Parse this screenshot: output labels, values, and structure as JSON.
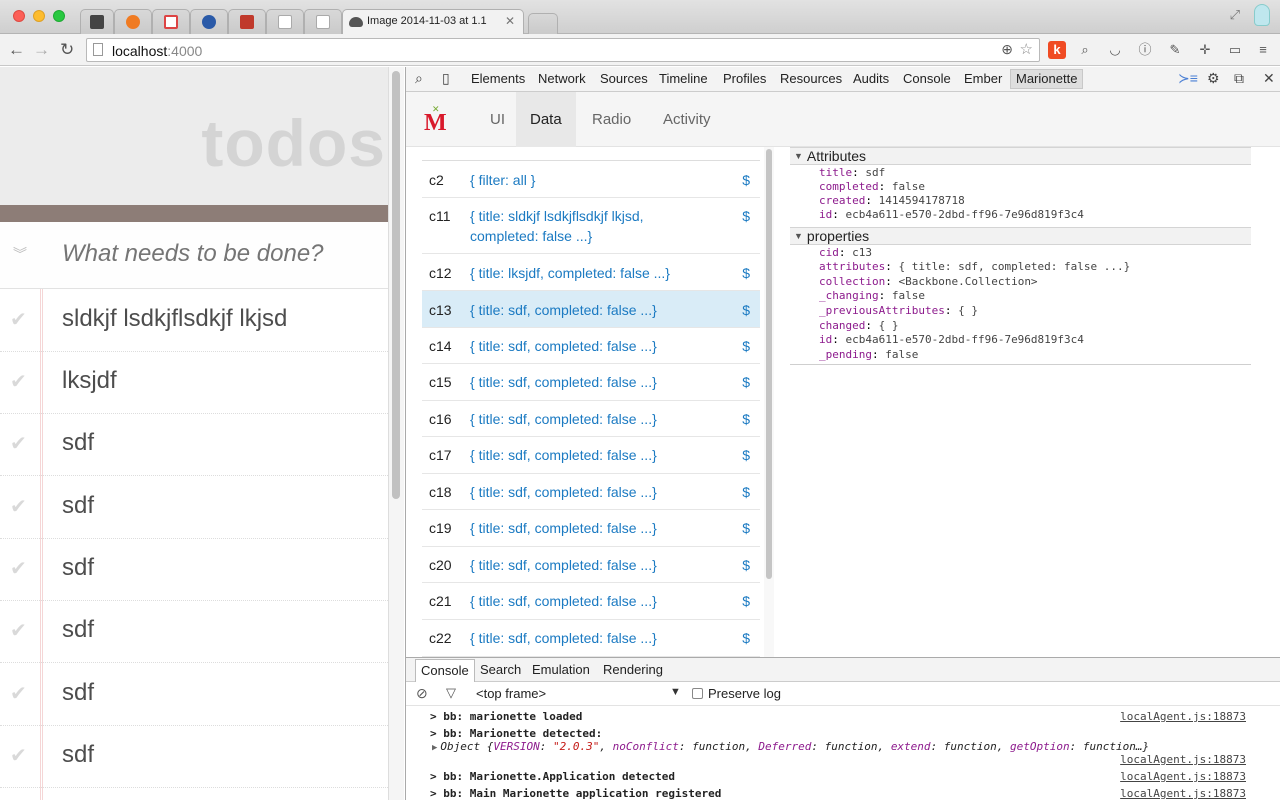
{
  "browser": {
    "tabs": [
      {
        "title": "",
        "favicon_color": "#444"
      },
      {
        "title": "",
        "favicon_color": "#f07b22"
      },
      {
        "title": "",
        "favicon_color": "#d44"
      },
      {
        "title": "",
        "favicon_color": "#2a5aa8"
      },
      {
        "title": "",
        "favicon_color": "#c0392b"
      },
      {
        "title": "",
        "favicon_color": "#ccc"
      },
      {
        "title": "",
        "favicon_color": "#ccc"
      },
      {
        "title": "Image 2014-11-03 at 1.1",
        "favicon_color": "#555"
      }
    ],
    "address": {
      "host": "localhost",
      "port": ":4000"
    }
  },
  "app": {
    "title": "todos",
    "new_todo_placeholder": "What needs to be done?",
    "todos": [
      "sldkjf lsdkjflsdkjf lkjsd",
      "lksjdf",
      "sdf",
      "sdf",
      "sdf",
      "sdf",
      "sdf",
      "sdf"
    ]
  },
  "devtools": {
    "tabs": [
      "Elements",
      "Network",
      "Sources",
      "Timeline",
      "Profiles",
      "Resources",
      "Audits",
      "Console",
      "Ember",
      "Marionette"
    ],
    "marionette": {
      "tabs": [
        "UI",
        "Data",
        "Radio",
        "Activity"
      ],
      "models": [
        {
          "cid": "c2",
          "summary": "{ filter: all }"
        },
        {
          "cid": "c11",
          "summary": "{ title: sldkjf lsdkjflsdkjf lkjsd, completed: false ...}"
        },
        {
          "cid": "c12",
          "summary": "{ title: lksjdf, completed: false ...}"
        },
        {
          "cid": "c13",
          "summary": "{ title: sdf, completed: false ...}"
        },
        {
          "cid": "c14",
          "summary": "{ title: sdf, completed: false ...}"
        },
        {
          "cid": "c15",
          "summary": "{ title: sdf, completed: false ...}"
        },
        {
          "cid": "c16",
          "summary": "{ title: sdf, completed: false ...}"
        },
        {
          "cid": "c17",
          "summary": "{ title: sdf, completed: false ...}"
        },
        {
          "cid": "c18",
          "summary": "{ title: sdf, completed: false ...}"
        },
        {
          "cid": "c19",
          "summary": "{ title: sdf, completed: false ...}"
        },
        {
          "cid": "c20",
          "summary": "{ title: sdf, completed: false ...}"
        },
        {
          "cid": "c21",
          "summary": "{ title: sdf, completed: false ...}"
        },
        {
          "cid": "c22",
          "summary": "{ title: sdf, completed: false ...}"
        }
      ],
      "dollar": "$",
      "inspector": {
        "attributes_title": "Attributes",
        "attributes": [
          {
            "key": "title",
            "value": "sdf"
          },
          {
            "key": "completed",
            "value": "false"
          },
          {
            "key": "created",
            "value": "1414594178718"
          },
          {
            "key": "id",
            "value": "ecb4a611-e570-2dbd-ff96-7e96d819f3c4"
          }
        ],
        "properties_title": "properties",
        "properties": [
          {
            "key": "cid",
            "value": "c13"
          },
          {
            "key": "attributes",
            "value": "{ title: sdf, completed: false ...}"
          },
          {
            "key": "collection",
            "value": "<Backbone.Collection>"
          },
          {
            "key": "_changing",
            "value": "false"
          },
          {
            "key": "_previousAttributes",
            "value": "{ }"
          },
          {
            "key": "changed",
            "value": "{ }"
          },
          {
            "key": "id",
            "value": "ecb4a611-e570-2dbd-ff96-7e96d819f3c4"
          },
          {
            "key": "_pending",
            "value": "false"
          }
        ]
      }
    },
    "drawer": {
      "tabs": [
        "Console",
        "Search",
        "Emulation",
        "Rendering"
      ],
      "frame": "<top frame>",
      "preserve_log": "Preserve log",
      "logs": [
        {
          "text": "> bb: marionette loaded",
          "source": "localAgent.js:18873"
        },
        {
          "text": "> bb: Marionette detected:",
          "source": ""
        },
        {
          "text": "> bb: Marionette.Application detected",
          "source": "localAgent.js:18873"
        },
        {
          "text": "> bb: Main Marionette application registered",
          "source": "localAgent.js:18873"
        }
      ],
      "object_line": {
        "prefix": "Object {",
        "version_key": "VERSION",
        "version_value": "\"2.0.3\"",
        "rest_1": ", ",
        "k2": "noConflict",
        "v2": ": function, ",
        "k3": "Deferred",
        "v3": ": function, ",
        "k4": "extend",
        "v4": ": function, ",
        "k5": "getOption",
        "v5": ": function…}",
        "source": "localAgent.js:18873"
      }
    }
  }
}
